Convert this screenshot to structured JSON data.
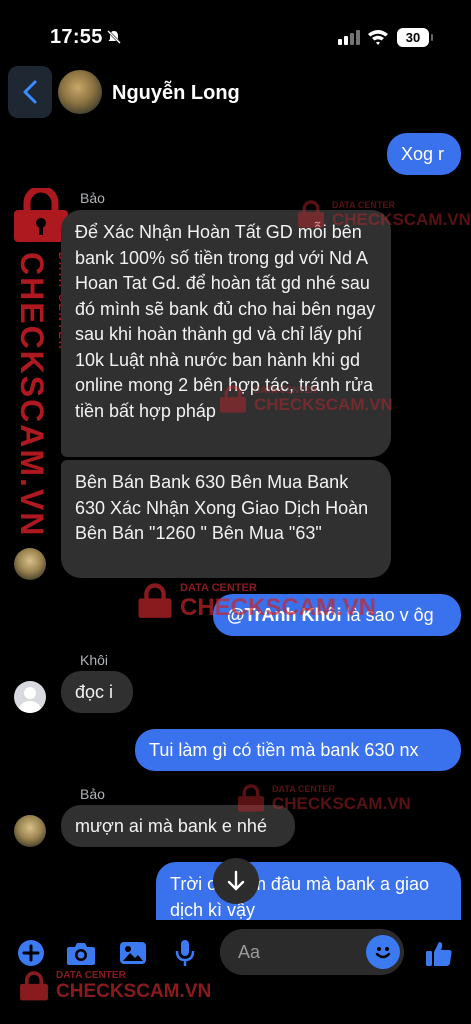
{
  "status_bar": {
    "time": "17:55",
    "battery": "30"
  },
  "header": {
    "contact_name": "Nguyễn Long",
    "back_icon": "chevron-left-icon"
  },
  "messages": [
    {
      "text": "Xog r"
    },
    {
      "sender": "Bảo",
      "text": "Để Xác Nhận Hoàn Tất GD mỗi bên bank 100% số tiền trong gd với Nd A Hoan Tat Gd. để hoàn tất gd nhé sau đó mình sẽ bank đủ cho hai bên ngay sau khi hoàn thành gd và chỉ lấy phí 10k Luật nhà nước ban hành khi gd online mong 2 bên hợp tác, tránh rửa tiền bất hợp pháp"
    },
    {
      "text": "Bên Bán Bank 630 Bên Mua Bank 630 Xác Nhận Xong Giao Dịch Hoàn Bên Bán \"1260 \" Bên Mua \"63\""
    },
    {
      "mention": "@TrAnh Khôi",
      "text": " là sao v ôg"
    },
    {
      "sender": "Khôi",
      "text": "đọc i"
    },
    {
      "text": "Tui làm gì có tiền mà bank 630 nx"
    },
    {
      "sender": "Bảo",
      "text": "mượn ai mà bank e nhé"
    },
    {
      "text": "Trời ơi kiếm đâu mà bank a giao dịch kì vậy"
    }
  ],
  "composer": {
    "placeholder": "Aa"
  },
  "watermark": {
    "brand": "CHECKSCAM.VN",
    "tagline": "DATA CENTER"
  },
  "colors": {
    "outgoing_bubble": "#3a72ee",
    "incoming_bubble": "#303030",
    "accent": "#3b7af0",
    "watermark": "#e8202a"
  }
}
